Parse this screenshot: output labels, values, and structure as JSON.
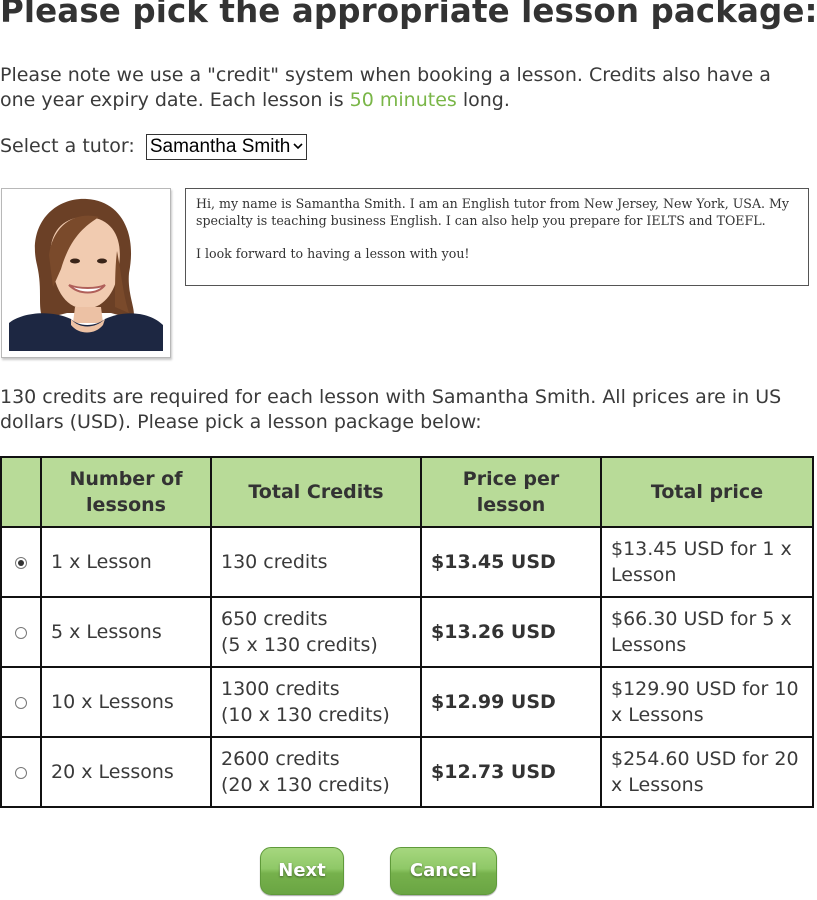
{
  "page": {
    "title": "Please pick the appropriate lesson package:",
    "intro_before": "Please note we use a \"credit\" system when booking a lesson. Credits also have a one year expiry date. Each lesson is ",
    "intro_highlight": "50 minutes",
    "intro_after": " long.",
    "highlight_color": "#7ab648"
  },
  "tutor_select": {
    "label": "Select a tutor:",
    "selected": "Samantha Smith"
  },
  "tutor": {
    "photo_icon": "tutor-photo",
    "bio_paragraph_1": "Hi, my name is Samantha Smith. I am an English tutor from New Jersey, New York, USA. My specialty is teaching business English. I can also help you prepare for IELTS and TOEFL.",
    "bio_paragraph_2": "I look forward to having a lesson with you!"
  },
  "credits_note": "130 credits are required for each lesson with Samantha Smith. All prices are in US dollars (USD). Please pick a lesson package below:",
  "table": {
    "header_color": "#b8db98",
    "headers": {
      "lessons": "Number of lessons",
      "credits": "Total Credits",
      "price_per_lesson": "Price per lesson",
      "total_price": "Total price"
    },
    "rows": [
      {
        "selected": true,
        "lessons": "1 x Lesson",
        "credits_line1": "130 credits",
        "credits_line2": "",
        "price_per_lesson": "$13.45 USD",
        "total_price": "$13.45 USD for 1 x Lesson"
      },
      {
        "selected": false,
        "lessons": "5 x Lessons",
        "credits_line1": "650 credits",
        "credits_line2": "(5 x 130 credits)",
        "price_per_lesson": "$13.26 USD",
        "total_price": "$66.30 USD for 5 x Lessons"
      },
      {
        "selected": false,
        "lessons": "10 x Lessons",
        "credits_line1": "1300 credits",
        "credits_line2": "(10 x 130 credits)",
        "price_per_lesson": "$12.99 USD",
        "total_price": "$129.90 USD for 10 x Lessons"
      },
      {
        "selected": false,
        "lessons": "20 x Lessons",
        "credits_line1": "2600 credits",
        "credits_line2": "(20 x 130 credits)",
        "price_per_lesson": "$12.73 USD",
        "total_price": "$254.60 USD for 20 x Lessons"
      }
    ]
  },
  "buttons": {
    "next": "Next",
    "cancel": "Cancel",
    "color": "#8fc867"
  }
}
